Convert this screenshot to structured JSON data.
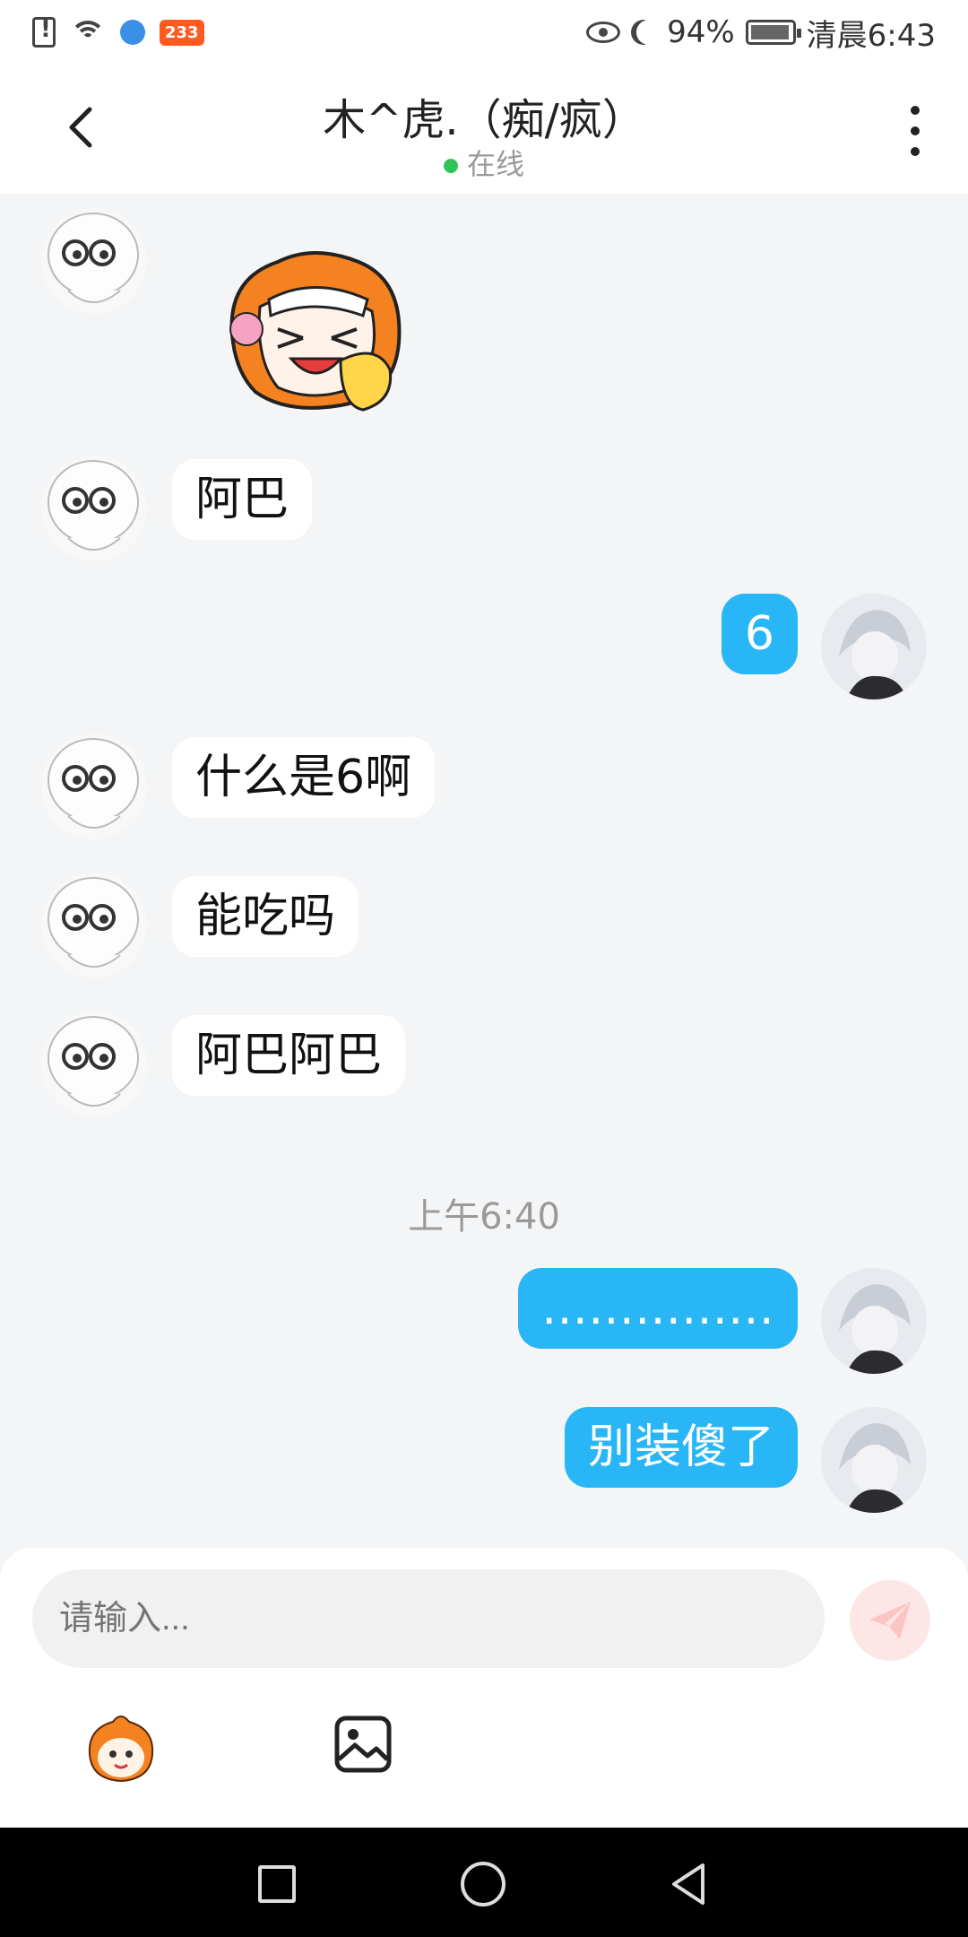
{
  "status_bar": {
    "badge": "233",
    "battery": "94%",
    "time": "清晨6:43"
  },
  "header": {
    "title": "木^虎.（痴/疯）",
    "status": "在线"
  },
  "messages": [
    {
      "side": "left",
      "type": "sticker",
      "sticker": "laughing-girl-sticker"
    },
    {
      "side": "left",
      "type": "text",
      "text": "阿巴"
    },
    {
      "side": "right",
      "type": "text",
      "text": "6"
    },
    {
      "side": "left",
      "type": "text",
      "text": "什么是6啊"
    },
    {
      "side": "left",
      "type": "text",
      "text": "能吃吗"
    },
    {
      "side": "left",
      "type": "text",
      "text": "阿巴阿巴"
    },
    {
      "side": "right",
      "type": "text",
      "text": "……………"
    },
    {
      "side": "right",
      "type": "text",
      "text": "别装傻了"
    }
  ],
  "timestamp": "上午6:40",
  "input": {
    "placeholder": "请输入..."
  },
  "colors": {
    "accent": "#29b6f6",
    "online": "#2fc45a",
    "send_disabled": "#fde7e6"
  },
  "icons": {
    "back": "chevron-left-icon",
    "more": "more-vertical-icon",
    "send": "paper-plane-icon",
    "emoji": "mascot-emoji-icon",
    "image": "image-icon"
  }
}
